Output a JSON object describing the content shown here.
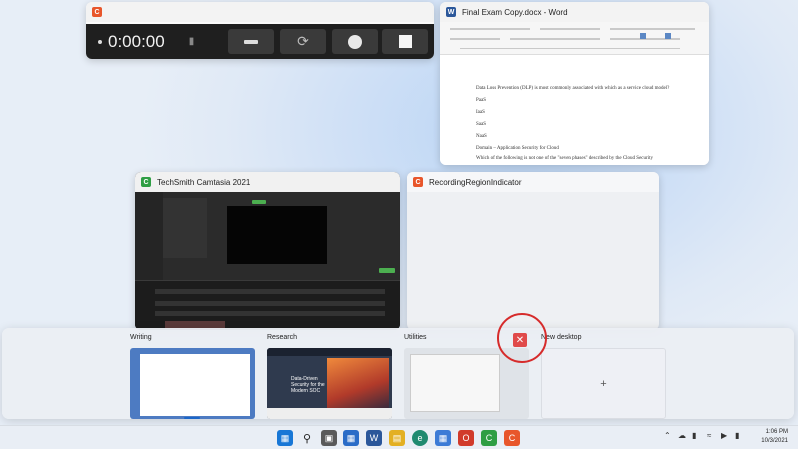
{
  "windows": {
    "recorder": {
      "timer": "0:00:00"
    },
    "word": {
      "title": "Final Exam Copy.docx - Word",
      "lines": [
        "Data Loss Prevention (DLP) is most commonly associated with which as a service cloud model?",
        "PaaS",
        "IaaS",
        "SaaS",
        "NaaS",
        "Domain – Application Security for Cloud",
        "Which of the following is not one of the \"seven phases\" described by the Cloud Security"
      ]
    },
    "camtasia": {
      "title": "TechSmith Camtasia 2021"
    },
    "region": {
      "title": "RecordingRegionIndicator"
    }
  },
  "desktops": [
    {
      "label": "Writing"
    },
    {
      "label": "Research",
      "headline": "Data-Driven Security for the Modern SOC"
    },
    {
      "label": "Utilities"
    },
    {
      "label": "New desktop",
      "plus": "+"
    }
  ],
  "taskbar": {
    "time": "1:06 PM",
    "date": "10/3/2021"
  }
}
